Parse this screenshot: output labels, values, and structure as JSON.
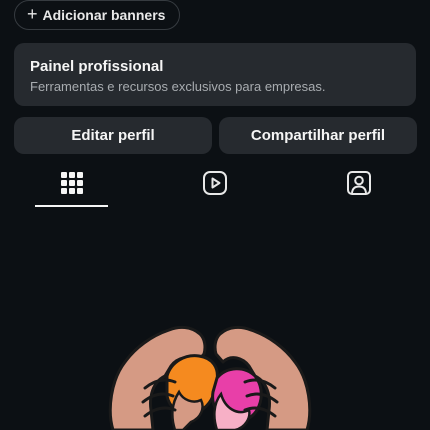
{
  "banners": {
    "icon": "plus-icon",
    "label": "Adicionar banners"
  },
  "professional_panel": {
    "title": "Painel profissional",
    "subtitle": "Ferramentas e recursos exclusivos para empresas."
  },
  "actions": {
    "edit_label": "Editar perfil",
    "share_label": "Compartilhar perfil"
  },
  "tabs": [
    {
      "icon": "grid-icon",
      "selected": true
    },
    {
      "icon": "reels-icon",
      "selected": false
    },
    {
      "icon": "tagged-user-icon",
      "selected": false
    }
  ],
  "colors": {
    "background": "#0c1014",
    "card": "#262a2f",
    "text": "#f5f5f5",
    "muted": "#a8acb0"
  }
}
